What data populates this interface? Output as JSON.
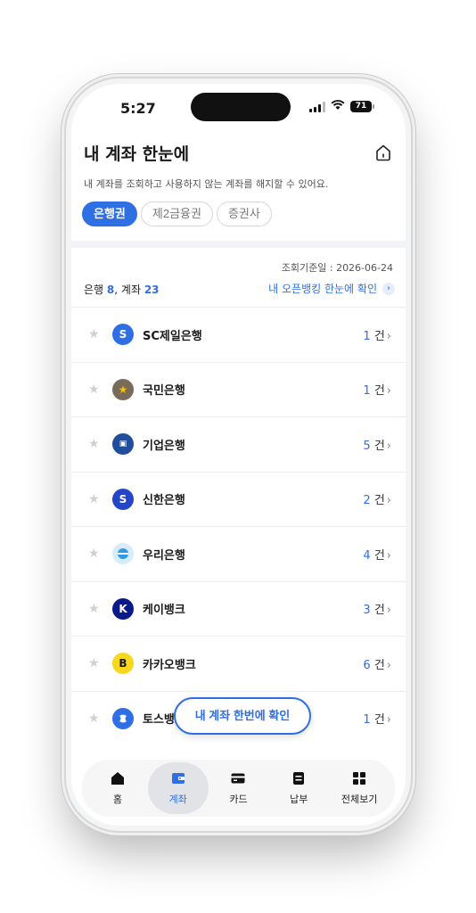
{
  "status_bar": {
    "time": "5:27",
    "battery": "71"
  },
  "header": {
    "title": "내 계좌 한눈에",
    "subtitle": "내 계좌를 조회하고 사용하지 않는 계좌를 해지할 수 있어요."
  },
  "tabs": [
    {
      "label": "은행권",
      "active": true
    },
    {
      "label": "제2금융권",
      "active": false
    },
    {
      "label": "증권사",
      "active": false
    }
  ],
  "summary": {
    "ref_date": "조회기준일 : 2026-06-24",
    "bank_label": "은행",
    "bank_count": "8",
    "account_label": ", 계좌",
    "account_count": "23",
    "openbank_link": "내 오픈뱅킹 한눈에 확인"
  },
  "banks": [
    {
      "name": "SC제일은행",
      "count": "1",
      "unit": "건",
      "color": "#2f6fe4",
      "icon": "sc-bank-logo"
    },
    {
      "name": "국민은행",
      "count": "1",
      "unit": "건",
      "color": "#7a6a5a",
      "icon": "kb-bank-logo"
    },
    {
      "name": "기업은행",
      "count": "5",
      "unit": "건",
      "color": "#1f4e9c",
      "icon": "ibk-bank-logo"
    },
    {
      "name": "신한은행",
      "count": "2",
      "unit": "건",
      "color": "#2346c8",
      "icon": "shinhan-bank-logo"
    },
    {
      "name": "우리은행",
      "count": "4",
      "unit": "건",
      "color": "#2d9be6",
      "icon": "woori-bank-logo"
    },
    {
      "name": "케이뱅크",
      "count": "3",
      "unit": "건",
      "color": "#0a1a8a",
      "icon": "kbank-logo"
    },
    {
      "name": "카카오뱅크",
      "count": "6",
      "unit": "건",
      "color": "#f9d71c",
      "icon": "kakaobank-logo"
    },
    {
      "name": "토스뱅크",
      "count": "1",
      "unit": "건",
      "color": "#2f6fe4",
      "icon": "tossbank-logo"
    }
  ],
  "floating_button": "내 계좌 한번에 확인",
  "bottom_nav": [
    {
      "label": "홈",
      "icon": "home-icon",
      "active": false
    },
    {
      "label": "계좌",
      "icon": "account-icon",
      "active": true
    },
    {
      "label": "카드",
      "icon": "card-icon",
      "active": false
    },
    {
      "label": "납부",
      "icon": "payment-icon",
      "active": false
    },
    {
      "label": "전체보기",
      "icon": "grid-icon",
      "active": false
    }
  ]
}
